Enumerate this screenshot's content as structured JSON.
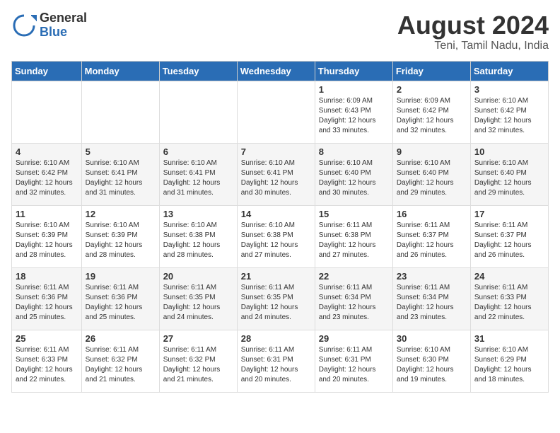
{
  "header": {
    "logo_general": "General",
    "logo_blue": "Blue",
    "month_year": "August 2024",
    "location": "Teni, Tamil Nadu, India"
  },
  "days_of_week": [
    "Sunday",
    "Monday",
    "Tuesday",
    "Wednesday",
    "Thursday",
    "Friday",
    "Saturday"
  ],
  "weeks": [
    [
      {
        "num": "",
        "info": ""
      },
      {
        "num": "",
        "info": ""
      },
      {
        "num": "",
        "info": ""
      },
      {
        "num": "",
        "info": ""
      },
      {
        "num": "1",
        "info": "Sunrise: 6:09 AM\nSunset: 6:43 PM\nDaylight: 12 hours\nand 33 minutes."
      },
      {
        "num": "2",
        "info": "Sunrise: 6:09 AM\nSunset: 6:42 PM\nDaylight: 12 hours\nand 32 minutes."
      },
      {
        "num": "3",
        "info": "Sunrise: 6:10 AM\nSunset: 6:42 PM\nDaylight: 12 hours\nand 32 minutes."
      }
    ],
    [
      {
        "num": "4",
        "info": "Sunrise: 6:10 AM\nSunset: 6:42 PM\nDaylight: 12 hours\nand 32 minutes."
      },
      {
        "num": "5",
        "info": "Sunrise: 6:10 AM\nSunset: 6:41 PM\nDaylight: 12 hours\nand 31 minutes."
      },
      {
        "num": "6",
        "info": "Sunrise: 6:10 AM\nSunset: 6:41 PM\nDaylight: 12 hours\nand 31 minutes."
      },
      {
        "num": "7",
        "info": "Sunrise: 6:10 AM\nSunset: 6:41 PM\nDaylight: 12 hours\nand 30 minutes."
      },
      {
        "num": "8",
        "info": "Sunrise: 6:10 AM\nSunset: 6:40 PM\nDaylight: 12 hours\nand 30 minutes."
      },
      {
        "num": "9",
        "info": "Sunrise: 6:10 AM\nSunset: 6:40 PM\nDaylight: 12 hours\nand 29 minutes."
      },
      {
        "num": "10",
        "info": "Sunrise: 6:10 AM\nSunset: 6:40 PM\nDaylight: 12 hours\nand 29 minutes."
      }
    ],
    [
      {
        "num": "11",
        "info": "Sunrise: 6:10 AM\nSunset: 6:39 PM\nDaylight: 12 hours\nand 28 minutes."
      },
      {
        "num": "12",
        "info": "Sunrise: 6:10 AM\nSunset: 6:39 PM\nDaylight: 12 hours\nand 28 minutes."
      },
      {
        "num": "13",
        "info": "Sunrise: 6:10 AM\nSunset: 6:38 PM\nDaylight: 12 hours\nand 28 minutes."
      },
      {
        "num": "14",
        "info": "Sunrise: 6:10 AM\nSunset: 6:38 PM\nDaylight: 12 hours\nand 27 minutes."
      },
      {
        "num": "15",
        "info": "Sunrise: 6:11 AM\nSunset: 6:38 PM\nDaylight: 12 hours\nand 27 minutes."
      },
      {
        "num": "16",
        "info": "Sunrise: 6:11 AM\nSunset: 6:37 PM\nDaylight: 12 hours\nand 26 minutes."
      },
      {
        "num": "17",
        "info": "Sunrise: 6:11 AM\nSunset: 6:37 PM\nDaylight: 12 hours\nand 26 minutes."
      }
    ],
    [
      {
        "num": "18",
        "info": "Sunrise: 6:11 AM\nSunset: 6:36 PM\nDaylight: 12 hours\nand 25 minutes."
      },
      {
        "num": "19",
        "info": "Sunrise: 6:11 AM\nSunset: 6:36 PM\nDaylight: 12 hours\nand 25 minutes."
      },
      {
        "num": "20",
        "info": "Sunrise: 6:11 AM\nSunset: 6:35 PM\nDaylight: 12 hours\nand 24 minutes."
      },
      {
        "num": "21",
        "info": "Sunrise: 6:11 AM\nSunset: 6:35 PM\nDaylight: 12 hours\nand 24 minutes."
      },
      {
        "num": "22",
        "info": "Sunrise: 6:11 AM\nSunset: 6:34 PM\nDaylight: 12 hours\nand 23 minutes."
      },
      {
        "num": "23",
        "info": "Sunrise: 6:11 AM\nSunset: 6:34 PM\nDaylight: 12 hours\nand 23 minutes."
      },
      {
        "num": "24",
        "info": "Sunrise: 6:11 AM\nSunset: 6:33 PM\nDaylight: 12 hours\nand 22 minutes."
      }
    ],
    [
      {
        "num": "25",
        "info": "Sunrise: 6:11 AM\nSunset: 6:33 PM\nDaylight: 12 hours\nand 22 minutes."
      },
      {
        "num": "26",
        "info": "Sunrise: 6:11 AM\nSunset: 6:32 PM\nDaylight: 12 hours\nand 21 minutes."
      },
      {
        "num": "27",
        "info": "Sunrise: 6:11 AM\nSunset: 6:32 PM\nDaylight: 12 hours\nand 21 minutes."
      },
      {
        "num": "28",
        "info": "Sunrise: 6:11 AM\nSunset: 6:31 PM\nDaylight: 12 hours\nand 20 minutes."
      },
      {
        "num": "29",
        "info": "Sunrise: 6:11 AM\nSunset: 6:31 PM\nDaylight: 12 hours\nand 20 minutes."
      },
      {
        "num": "30",
        "info": "Sunrise: 6:10 AM\nSunset: 6:30 PM\nDaylight: 12 hours\nand 19 minutes."
      },
      {
        "num": "31",
        "info": "Sunrise: 6:10 AM\nSunset: 6:29 PM\nDaylight: 12 hours\nand 18 minutes."
      }
    ]
  ]
}
